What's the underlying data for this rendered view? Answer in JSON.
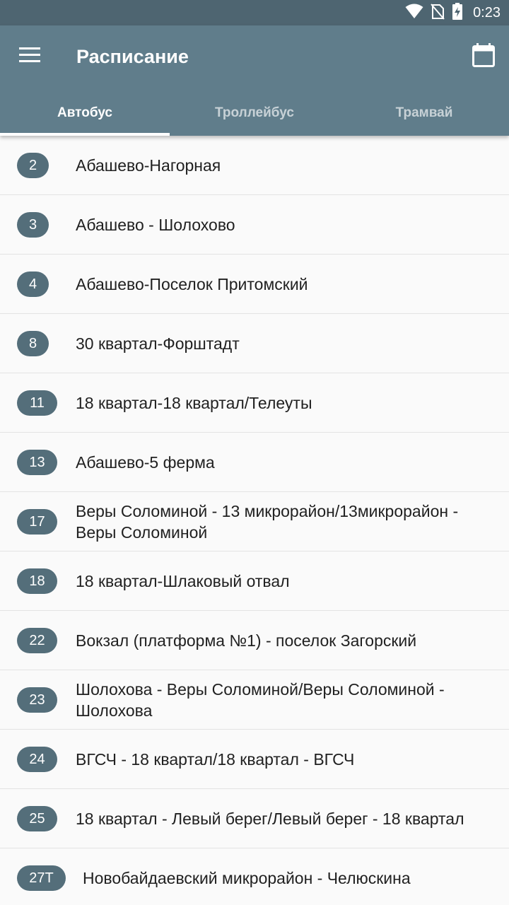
{
  "status_bar": {
    "time": "0:23",
    "icons": [
      "wifi-icon",
      "no-sim-icon",
      "battery-charging-icon"
    ]
  },
  "app_bar": {
    "title": "Расписание",
    "menu_icon": "menu-icon",
    "calendar_icon": "calendar-icon"
  },
  "tabs": [
    {
      "label": "Автобус",
      "active": true
    },
    {
      "label": "Троллейбус",
      "active": false
    },
    {
      "label": "Трамвай",
      "active": false
    }
  ],
  "routes": [
    {
      "number": "2",
      "name": "Абашево-Нагорная"
    },
    {
      "number": "3",
      "name": "Абашево - Шолохово"
    },
    {
      "number": "4",
      "name": "Абашево-Поселок Притомский"
    },
    {
      "number": "8",
      "name": "30 квартал-Форштадт"
    },
    {
      "number": "11",
      "name": "18 квартал-18 квартал/Телеуты"
    },
    {
      "number": "13",
      "name": "Абашево-5 ферма"
    },
    {
      "number": "17",
      "name": "Веры Соломиной - 13 микрорайон/13микрорайон - Веры Соломиной"
    },
    {
      "number": "18",
      "name": "18 квартал-Шлаковый отвал"
    },
    {
      "number": "22",
      "name": "Вокзал (платформа №1) - поселок Загорский"
    },
    {
      "number": "23",
      "name": "Шолохова - Веры Соломиной/Веры Соломиной - Шолохова"
    },
    {
      "number": "24",
      "name": "ВГСЧ - 18 квартал/18 квартал - ВГСЧ"
    },
    {
      "number": "25",
      "name": "18 квартал - Левый берег/Левый берег - 18 квартал"
    },
    {
      "number": "27Т",
      "name": "Новобайдаевский микрорайон - Челюскина"
    }
  ],
  "colors": {
    "app_bar": "#607d8b",
    "status_bar": "#4e6571",
    "badge": "#546e7a"
  }
}
